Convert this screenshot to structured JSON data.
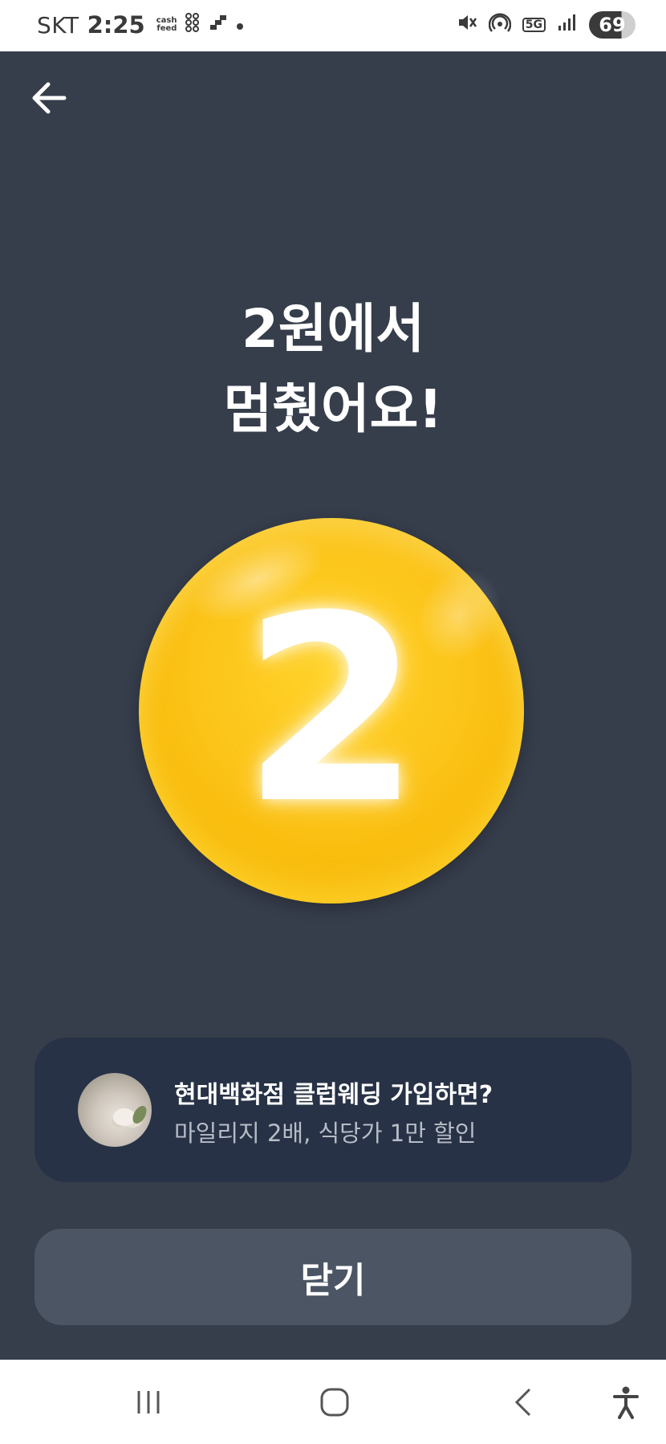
{
  "status_bar": {
    "carrier": "SKT",
    "time": "2:25",
    "cashfeed_line1": "cash",
    "cashfeed_line2": "feed",
    "network": "5G",
    "battery": "69"
  },
  "header": {
    "back_icon": "arrow-left-icon"
  },
  "result": {
    "title_line1": "2원에서",
    "title_line2": "멈췄어요!",
    "coin_number": "2",
    "coin_color": "#fcc419"
  },
  "promo": {
    "title": "현대백화점 클럽웨딩 가입하면?",
    "subtitle": "마일리지 2배, 식당가 1만 할인",
    "thumbnail_icon": "wedding-photo"
  },
  "actions": {
    "close_label": "닫기"
  },
  "nav": {
    "recent_icon": "recent-apps-icon",
    "home_icon": "home-icon",
    "back_icon": "back-icon",
    "accessibility_icon": "accessibility-icon"
  },
  "colors": {
    "background": "#363d4b",
    "card": "#273246",
    "button": "#4b5564"
  }
}
